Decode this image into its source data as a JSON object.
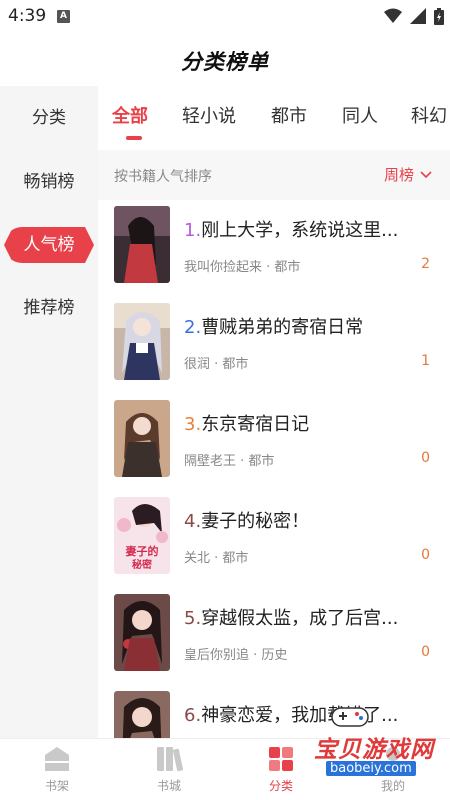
{
  "status": {
    "time": "4:39",
    "notification_letter": "A"
  },
  "header": {
    "title": "分类榜单"
  },
  "sidebar": {
    "items": [
      {
        "label": "分类"
      },
      {
        "label": "畅销榜"
      },
      {
        "label": "人气榜",
        "active": true
      },
      {
        "label": "推荐榜"
      }
    ]
  },
  "tabs": [
    {
      "label": "全部",
      "active": true
    },
    {
      "label": "轻小说"
    },
    {
      "label": "都市"
    },
    {
      "label": "同人"
    },
    {
      "label": "科幻"
    }
  ],
  "sort": {
    "label": "按书籍人气排序",
    "selected": "周榜"
  },
  "books": [
    {
      "rank": "1.",
      "title": "刚上大学，系统说这里...",
      "author": "我叫你捡起来",
      "genre": "都市",
      "count": "2"
    },
    {
      "rank": "2.",
      "title": "曹贼弟弟的寄宿日常",
      "author": "很润",
      "genre": "都市",
      "count": "1"
    },
    {
      "rank": "3.",
      "title": "东京寄宿日记",
      "author": "隔壁老王",
      "genre": "都市",
      "count": "0"
    },
    {
      "rank": "4.",
      "title": "妻子的秘密！",
      "author": "关北",
      "genre": "都市",
      "count": "0",
      "cover_text": "妻子的秘密"
    },
    {
      "rank": "5.",
      "title": "穿越假太监，成了后宫...",
      "author": "皇后你别追",
      "genre": "历史",
      "count": "0"
    },
    {
      "rank": "6.",
      "title": "神豪恋爱，我加载错了...",
      "author": "",
      "genre": "",
      "count": ""
    }
  ],
  "meta_separator": " · ",
  "bottom_nav": {
    "items": [
      {
        "label": "书架"
      },
      {
        "label": "书城"
      },
      {
        "label": "分类",
        "active": true
      },
      {
        "label": "我的"
      }
    ]
  },
  "watermark": {
    "text": "宝贝游戏网",
    "url": "baobeiy.com"
  },
  "colors": {
    "accent": "#e8414a",
    "count": "#e07a3a",
    "sidebar_bg": "#f5f5f5"
  }
}
